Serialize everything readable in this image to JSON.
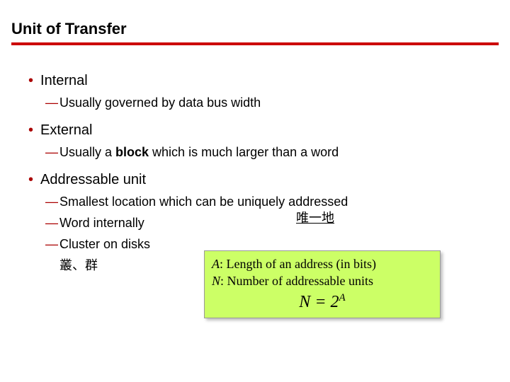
{
  "title": "Unit of Transfer",
  "bullets": [
    {
      "label": "Internal",
      "subs": [
        {
          "text": "Usually governed by data bus width"
        }
      ]
    },
    {
      "label": "External",
      "subs": [
        {
          "pre": "Usually a ",
          "bold": "block",
          "post": " which is much larger than a word"
        }
      ]
    },
    {
      "label": "Addressable unit",
      "subs": [
        {
          "text": "Smallest location which can be uniquely addressed"
        },
        {
          "text": "Word internally"
        },
        {
          "text": "Cluster on disks",
          "indent": "叢、群"
        }
      ]
    }
  ],
  "annotation_unique": "唯一地",
  "formula": {
    "line1_var": "A",
    "line1_rest": ": Length of an address (in bits)",
    "line2_var": "N",
    "line2_rest": ": Number of addressable units",
    "eq_left": "N",
    "eq_mid": " = 2",
    "eq_sup": "A"
  }
}
